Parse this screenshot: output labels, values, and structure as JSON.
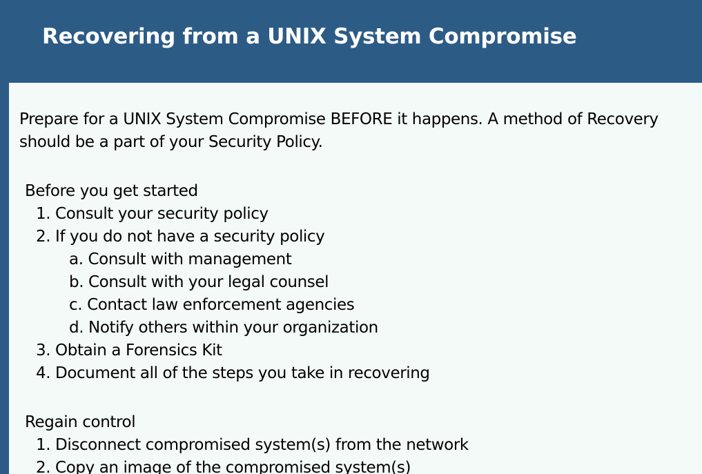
{
  "slide": {
    "title": "Recovering from a UNIX System Compromise",
    "intro": [
      "Prepare for a UNIX System Compromise BEFORE it happens.  A method of Recovery",
      "should be a part of your Security Policy."
    ],
    "sections": [
      {
        "heading": "Before you get started",
        "items": [
          "1. Consult your security policy",
          "2. If you do not have a security policy",
          "a. Consult with management",
          "b. Consult with your legal counsel",
          "c. Contact law enforcement agencies",
          "d. Notify others within your organization",
          "3. Obtain a Forensics Kit",
          "4. Document all of the steps you take in recovering"
        ]
      },
      {
        "heading": "Regain control",
        "items": [
          "1. Disconnect compromised system(s) from the network",
          "2. Copy an image of the compromised system(s)"
        ]
      }
    ]
  }
}
